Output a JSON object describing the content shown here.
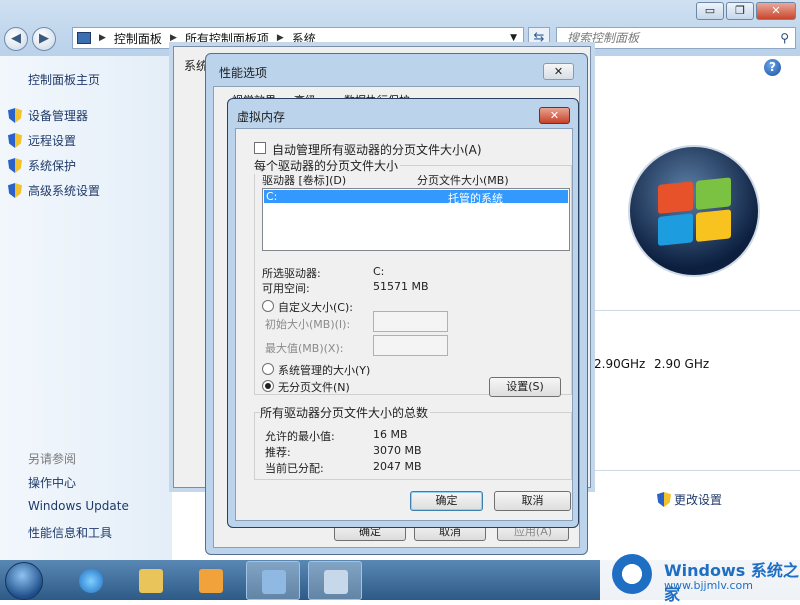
{
  "explorer": {
    "breadcrumb": [
      "控制面板",
      "所有控制面板项",
      "系统"
    ],
    "search_placeholder": "搜索控制面板",
    "controls": {
      "minimize": "▭",
      "maximize": "❐",
      "close": "✕"
    }
  },
  "sidebar": {
    "home": "控制面板主页",
    "items": [
      "设备管理器",
      "远程设置",
      "系统保护",
      "高级系统设置"
    ],
    "see_also_title": "另请参阅",
    "see_also": [
      "操作中心",
      "Windows Update",
      "性能信息和工具"
    ]
  },
  "main": {
    "cpu_values": [
      "2.90GHz",
      "2.90 GHz"
    ],
    "change_settings": "更改设置"
  },
  "system_window": {
    "title": "系统"
  },
  "perf_dialog": {
    "title": "性能选项",
    "tabs": [
      "视觉效果",
      "高级",
      "数据执行保护"
    ],
    "buttons": {
      "ok": "确定",
      "cancel": "取消",
      "apply": "应用(A)"
    }
  },
  "vm_dialog": {
    "title": "虚拟内存",
    "auto_manage_label": "自动管理所有驱动器的分页文件大小(A)",
    "auto_manage_checked": false,
    "per_drive_group": "每个驱动器的分页文件大小",
    "col_drive": "驱动器 [卷标](D)",
    "col_size": "分页文件大小(MB)",
    "drive_rows": [
      {
        "drive": "C:",
        "size": "托管的系统"
      }
    ],
    "selected_drive_label": "所选驱动器:",
    "selected_drive_value": "C:",
    "free_space_label": "可用空间:",
    "free_space_value": "51571 MB",
    "custom_size_label": "自定义大小(C):",
    "initial_size_label": "初始大小(MB)(I):",
    "max_size_label": "最大值(MB)(X):",
    "system_managed_label": "系统管理的大小(Y)",
    "no_paging_label": "无分页文件(N)",
    "set_button": "设置(S)",
    "total_group": "所有驱动器分页文件大小的总数",
    "min_allowed_label": "允许的最小值:",
    "min_allowed_value": "16 MB",
    "recommended_label": "推荐:",
    "recommended_value": "3070 MB",
    "allocated_label": "当前已分配:",
    "allocated_value": "2047 MB",
    "ok_button": "确定",
    "cancel_button": "取消"
  },
  "watermark": {
    "title": "Windows 系统之家",
    "url": "www.bjjmlv.com"
  }
}
